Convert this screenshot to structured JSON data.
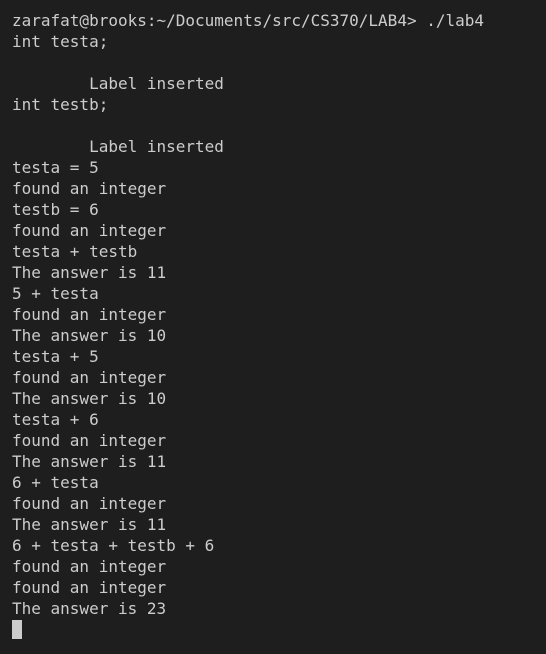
{
  "terminal": {
    "lines": [
      "zarafat@brooks:~/Documents/src/CS370/LAB4> ./lab4",
      "int testa;",
      "",
      "        Label inserted",
      "int testb;",
      "",
      "        Label inserted",
      "testa = 5",
      "found an integer",
      "testb = 6",
      "found an integer",
      "testa + testb",
      "The answer is 11",
      "5 + testa",
      "found an integer",
      "The answer is 10",
      "testa + 5",
      "found an integer",
      "The answer is 10",
      "testa + 6",
      "found an integer",
      "The answer is 11",
      "6 + testa",
      "found an integer",
      "The answer is 11",
      "6 + testa + testb + 6",
      "found an integer",
      "found an integer",
      "The answer is 23"
    ]
  },
  "colors": {
    "background": "#1e1e1e",
    "text": "#cccccc",
    "cursor": "#cccccc"
  }
}
